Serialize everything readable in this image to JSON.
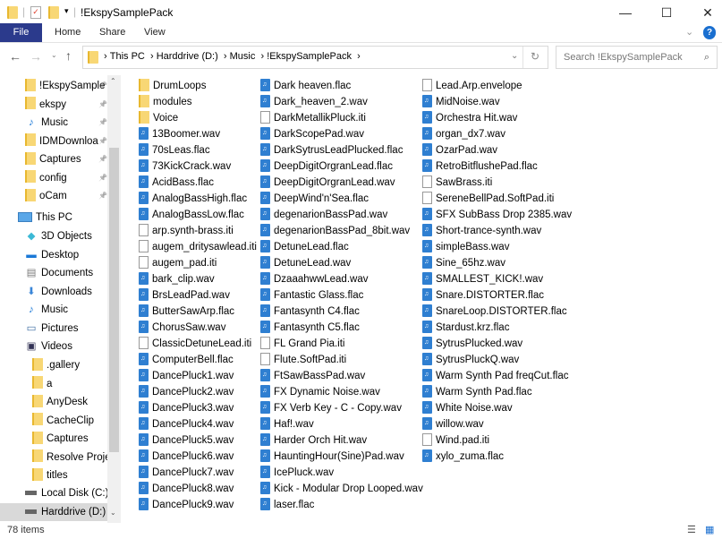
{
  "window": {
    "title": "!EkspySamplePack",
    "minimize": "—",
    "maximize": "☐",
    "close": "✕"
  },
  "ribbon": {
    "tabs": [
      "File",
      "Home",
      "Share",
      "View"
    ],
    "expand": "⌄",
    "help": "?"
  },
  "address": {
    "crumbs": [
      "This PC",
      "Harddrive (D:)",
      "Music",
      "!EkspySamplePack"
    ],
    "search_placeholder": "Search !EkspySamplePack"
  },
  "nav": {
    "quick_access": [
      {
        "label": "!EkspySample",
        "icon": "folder"
      },
      {
        "label": "ekspy",
        "icon": "folder"
      },
      {
        "label": "Music",
        "icon": "music"
      },
      {
        "label": "IDMDownloa",
        "icon": "folder"
      },
      {
        "label": "Captures",
        "icon": "folder"
      },
      {
        "label": "config",
        "icon": "folder"
      },
      {
        "label": "oCam",
        "icon": "folder"
      }
    ],
    "this_pc": "This PC",
    "pc_items": [
      {
        "label": "3D Objects",
        "icon": "3d"
      },
      {
        "label": "Desktop",
        "icon": "desktop"
      },
      {
        "label": "Documents",
        "icon": "documents"
      },
      {
        "label": "Downloads",
        "icon": "downloads"
      },
      {
        "label": "Music",
        "icon": "music"
      },
      {
        "label": "Pictures",
        "icon": "pictures"
      },
      {
        "label": "Videos",
        "icon": "videos"
      }
    ],
    "video_folders": [
      ".gallery",
      "a",
      "AnyDesk",
      "CacheClip",
      "Captures",
      "Resolve Project",
      "titles"
    ],
    "drives": [
      "Local Disk (C:)",
      "Harddrive (D:)"
    ]
  },
  "files": [
    [
      [
        "DrumLoops",
        "folder"
      ],
      [
        "modules",
        "folder"
      ],
      [
        "Voice",
        "folder"
      ],
      [
        "13Boomer.wav",
        "audio"
      ],
      [
        "70sLeas.flac",
        "audio"
      ],
      [
        "73KickCrack.wav",
        "audio"
      ],
      [
        "AcidBass.flac",
        "audio"
      ],
      [
        "AnalogBassHigh.flac",
        "audio"
      ],
      [
        "AnalogBassLow.flac",
        "audio"
      ],
      [
        "arp.synth-brass.iti",
        "file"
      ],
      [
        "augem_dritysawlead.iti",
        "file"
      ],
      [
        "augem_pad.iti",
        "file"
      ],
      [
        "bark_clip.wav",
        "audio"
      ],
      [
        "BrsLeadPad.wav",
        "audio"
      ],
      [
        "ButterSawArp.flac",
        "audio"
      ],
      [
        "ChorusSaw.wav",
        "audio"
      ],
      [
        "ClassicDetuneLead.iti",
        "file"
      ],
      [
        "ComputerBell.flac",
        "audio"
      ],
      [
        "DancePluck1.wav",
        "audio"
      ],
      [
        "DancePluck2.wav",
        "audio"
      ],
      [
        "DancePluck3.wav",
        "audio"
      ],
      [
        "DancePluck4.wav",
        "audio"
      ],
      [
        "DancePluck5.wav",
        "audio"
      ],
      [
        "DancePluck6.wav",
        "audio"
      ],
      [
        "DancePluck7.wav",
        "audio"
      ],
      [
        "DancePluck8.wav",
        "audio"
      ],
      [
        "DancePluck9.wav",
        "audio"
      ]
    ],
    [
      [
        "Dark heaven.flac",
        "audio"
      ],
      [
        "Dark_heaven_2.wav",
        "audio"
      ],
      [
        "DarkMetallikPluck.iti",
        "file"
      ],
      [
        "DarkScopePad.wav",
        "audio"
      ],
      [
        "DarkSytrusLeadPlucked.flac",
        "audio"
      ],
      [
        "DeepDigitOrgranLead.flac",
        "audio"
      ],
      [
        "DeepDigitOrgranLead.wav",
        "audio"
      ],
      [
        "DeepWind'n'Sea.flac",
        "audio"
      ],
      [
        "degenarionBassPad.wav",
        "audio"
      ],
      [
        "degenarionBassPad_8bit.wav",
        "audio"
      ],
      [
        "DetuneLead.flac",
        "audio"
      ],
      [
        "DetuneLead.wav",
        "audio"
      ],
      [
        "DzaaahwwLead.wav",
        "audio"
      ],
      [
        "Fantastic Glass.flac",
        "audio"
      ],
      [
        "Fantasynth C4.flac",
        "audio"
      ],
      [
        "Fantasynth C5.flac",
        "audio"
      ],
      [
        "FL Grand Pia.iti",
        "file"
      ],
      [
        "Flute.SoftPad.iti",
        "file"
      ],
      [
        "FtSawBassPad.wav",
        "audio"
      ],
      [
        "FX Dynamic Noise.wav",
        "audio"
      ],
      [
        "FX Verb Key - C - Copy.wav",
        "audio"
      ],
      [
        "Haf!.wav",
        "audio"
      ],
      [
        "Harder Orch Hit.wav",
        "audio"
      ],
      [
        "HauntingHour(Sine)Pad.wav",
        "audio"
      ],
      [
        "IcePluck.wav",
        "audio"
      ],
      [
        "Kick - Modular Drop Looped.wav",
        "audio"
      ],
      [
        "laser.flac",
        "audio"
      ]
    ],
    [
      [
        "Lead.Arp.envelope",
        "file"
      ],
      [
        "MidNoise.wav",
        "audio"
      ],
      [
        "Orchestra Hit.wav",
        "audio"
      ],
      [
        "organ_dx7.wav",
        "audio"
      ],
      [
        "OzarPad.wav",
        "audio"
      ],
      [
        "RetroBitflushePad.flac",
        "audio"
      ],
      [
        "SawBrass.iti",
        "file"
      ],
      [
        "SereneBellPad.SoftPad.iti",
        "file"
      ],
      [
        "SFX SubBass Drop 2385.wav",
        "audio"
      ],
      [
        "Short-trance-synth.wav",
        "audio"
      ],
      [
        "simpleBass.wav",
        "audio"
      ],
      [
        "Sine_65hz.wav",
        "audio"
      ],
      [
        "SMALLEST_KICK!.wav",
        "audio"
      ],
      [
        "Snare.DISTORTER.flac",
        "audio"
      ],
      [
        "SnareLoop.DISTORTER.flac",
        "audio"
      ],
      [
        "Stardust.krz.flac",
        "audio"
      ],
      [
        "SytrusPlucked.wav",
        "audio"
      ],
      [
        "SytrusPluckQ.wav",
        "audio"
      ],
      [
        "Warm Synth Pad freqCut.flac",
        "audio"
      ],
      [
        "Warm Synth Pad.flac",
        "audio"
      ],
      [
        "White Noise.wav",
        "audio"
      ],
      [
        "willow.wav",
        "audio"
      ],
      [
        "Wind.pad.iti",
        "file"
      ],
      [
        "xylo_zuma.flac",
        "audio"
      ]
    ]
  ],
  "status": {
    "count": "78 items"
  }
}
